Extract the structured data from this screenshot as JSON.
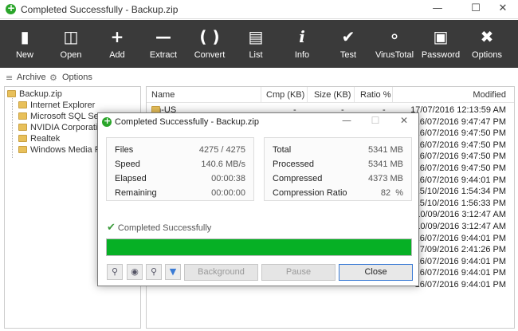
{
  "window": {
    "title": "Completed Successfully - Backup.zip"
  },
  "toolbar": {
    "buttons": [
      {
        "label": "New",
        "icon": "new-file-icon"
      },
      {
        "label": "Open",
        "icon": "open-book-icon"
      },
      {
        "label": "Add",
        "icon": "plus-icon"
      },
      {
        "label": "Extract",
        "icon": "minus-icon"
      },
      {
        "label": "Convert",
        "icon": "convert-icon"
      },
      {
        "label": "List",
        "icon": "list-icon"
      },
      {
        "label": "Info",
        "icon": "info-icon"
      },
      {
        "label": "Test",
        "icon": "check-icon"
      },
      {
        "label": "VirusTotal",
        "icon": "shield-icon"
      },
      {
        "label": "Password",
        "icon": "lock-icon"
      },
      {
        "label": "Options",
        "icon": "tools-icon"
      }
    ],
    "background": "#3a3a3a"
  },
  "subbar": {
    "archive": "Archive",
    "options": "Options"
  },
  "tree": {
    "root": "Backup.zip",
    "items": [
      "Internet Explorer",
      "Microsoft SQL Server",
      "NVIDIA Corporation",
      "Realtek",
      "Windows Media Player"
    ]
  },
  "list": {
    "columns": {
      "name": "Name",
      "cmp": "Cmp (KB)",
      "size": "Size (KB)",
      "ratio": "Ratio %",
      "modified": "Modified"
    },
    "rows": [
      {
        "name": "en-US",
        "cmp": "-",
        "size": "-",
        "ratio": "-",
        "modified": "17/07/2016 12:13:59 AM"
      },
      {
        "modified": "16/07/2016 9:47:47 PM"
      },
      {
        "modified": "16/07/2016 9:47:50 PM"
      },
      {
        "modified": "16/07/2016 9:47:50 PM"
      },
      {
        "modified": "16/07/2016 9:47:50 PM"
      },
      {
        "modified": "16/07/2016 9:47:50 PM"
      },
      {
        "modified": "16/07/2016 9:44:01 PM"
      },
      {
        "modified": "15/10/2016 1:54:34 PM"
      },
      {
        "modified": "15/10/2016 1:56:33 PM"
      },
      {
        "modified": "10/09/2016 3:12:47 AM"
      },
      {
        "modified": "10/09/2016 3:12:47 AM"
      },
      {
        "modified": "16/07/2016 9:44:01 PM"
      },
      {
        "modified": "7/09/2016 2:41:26 PM"
      },
      {
        "modified": "16/07/2016 9:44:01 PM"
      },
      {
        "modified": "16/07/2016 9:44:01 PM"
      },
      {
        "modified": "16/07/2016 9:44:01 PM"
      }
    ]
  },
  "dialog": {
    "title": "Completed Successfully - Backup.zip",
    "left_stats": [
      {
        "label": "Files",
        "value": "4275 / 4275"
      },
      {
        "label": "Speed",
        "value": "140.6 MB/s"
      },
      {
        "label": "Elapsed",
        "value": "00:00:38"
      },
      {
        "label": "Remaining",
        "value": "00:00:00"
      }
    ],
    "right_stats": [
      {
        "label": "Total",
        "value": "5341 MB"
      },
      {
        "label": "Processed",
        "value": "5341 MB"
      },
      {
        "label": "Compressed",
        "value": "4373 MB"
      },
      {
        "label": "Compression Ratio",
        "value": "82  %"
      }
    ],
    "status": "Completed Successfully",
    "progress": 1.0,
    "progress_color": "#06b025",
    "buttons": {
      "background": "Background",
      "pause": "Pause",
      "close": "Close"
    }
  }
}
